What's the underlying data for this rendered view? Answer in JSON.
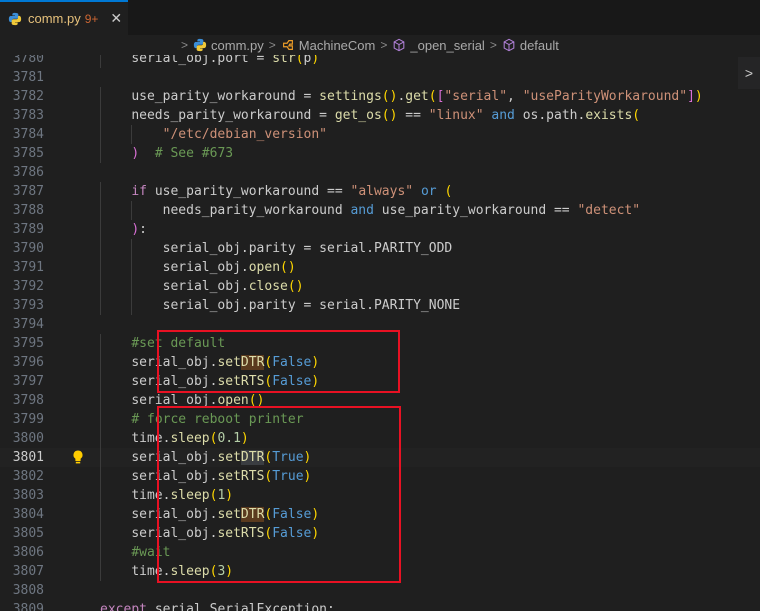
{
  "tab": {
    "filename": "comm.py",
    "badge": "9+",
    "close": "✕"
  },
  "breadcrumb": [
    {
      "label": "comm.py",
      "icon": "python-icon"
    },
    {
      "label": "MachineCom",
      "icon": "class-icon"
    },
    {
      "label": "_open_serial",
      "icon": "method-icon"
    },
    {
      "label": "default",
      "icon": "method-icon"
    }
  ],
  "editor": {
    "current_line": "3801",
    "lines": [
      {
        "n": "3780",
        "html": "        serial_obj.port = str(p)"
      },
      {
        "n": "3781",
        "html": ""
      },
      {
        "n": "3782",
        "html": "        use_parity_workaround = settings().get([\"serial\", \"useParityWorkaround\"])"
      },
      {
        "n": "3783",
        "html": "        needs_parity_workaround = get_os() == \"linux\" and os.path.exists("
      },
      {
        "n": "3784",
        "html": "            \"/etc/debian_version\""
      },
      {
        "n": "3785",
        "html": "        )  # See #673"
      },
      {
        "n": "3786",
        "html": ""
      },
      {
        "n": "3787",
        "html": "        if use_parity_workaround == \"always\" or ("
      },
      {
        "n": "3788",
        "html": "            needs_parity_workaround and use_parity_workaround == \"detect\""
      },
      {
        "n": "3789",
        "html": "        ):"
      },
      {
        "n": "3790",
        "html": "            serial_obj.parity = serial.PARITY_ODD"
      },
      {
        "n": "3791",
        "html": "            serial_obj.open()"
      },
      {
        "n": "3792",
        "html": "            serial_obj.close()"
      },
      {
        "n": "3793",
        "html": "            serial_obj.parity = serial.PARITY_NONE"
      },
      {
        "n": "3794",
        "html": ""
      },
      {
        "n": "3795",
        "html": "        #set default"
      },
      {
        "n": "3796",
        "html": "        serial_obj.setDTR(False)"
      },
      {
        "n": "3797",
        "html": "        serial_obj.setRTS(False)"
      },
      {
        "n": "3798",
        "html": "        serial_obj.open()"
      },
      {
        "n": "3799",
        "html": "        # force reboot printer"
      },
      {
        "n": "3800",
        "html": "        time.sleep(0.1)"
      },
      {
        "n": "3801",
        "html": "        serial_obj.setDTR(True)"
      },
      {
        "n": "3802",
        "html": "        serial_obj.setRTS(True)"
      },
      {
        "n": "3803",
        "html": "        time.sleep(1)"
      },
      {
        "n": "3804",
        "html": "        serial_obj.setDTR(False)"
      },
      {
        "n": "3805",
        "html": "        serial_obj.setRTS(False)"
      },
      {
        "n": "3806",
        "html": "        #wait"
      },
      {
        "n": "3807",
        "html": "        time.sleep(3)"
      },
      {
        "n": "3808",
        "html": ""
      },
      {
        "n": "3809",
        "html": "    except serial.SerialException:"
      }
    ]
  },
  "colors": {
    "keyword": "#569cd6",
    "control": "#c586c0",
    "string": "#ce9178",
    "number": "#b5cea8",
    "comment": "#6a9955",
    "function": "#dcdcaa",
    "annotation_box": "#e81123"
  }
}
